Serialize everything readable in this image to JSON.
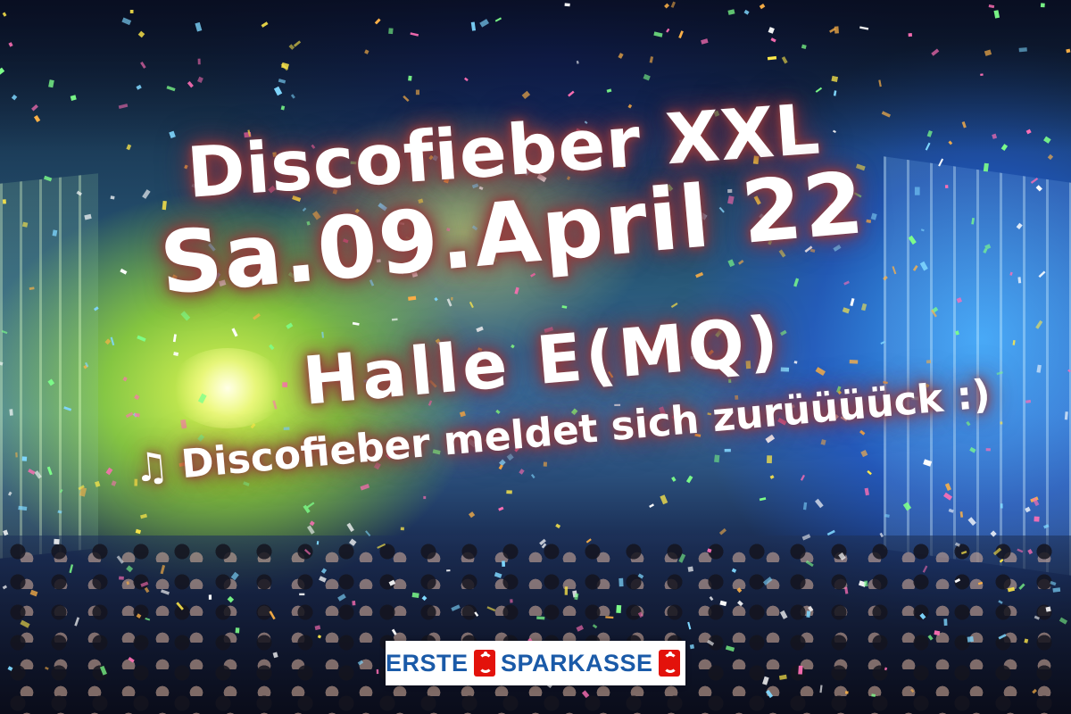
{
  "poster": {
    "title": "Discofieber XXL",
    "date": "Sa.09.April 22",
    "venue": "Halle E(MQ)",
    "tagline": "Discofieber meldet sich zurüüüück :)",
    "tagline_icon": "music-note-icon",
    "sponsor": {
      "word1": "ERSTE",
      "word2": "SPARKASSE",
      "logo_icon": "sparkasse-s-logo-icon"
    }
  },
  "colors": {
    "text": "#ffffff",
    "glow": "#963c3c",
    "sponsor_blue": "#1a5aa8",
    "sponsor_red": "#e3120b",
    "light_yellow": "#e8ff50",
    "light_blue": "#3caaff"
  }
}
